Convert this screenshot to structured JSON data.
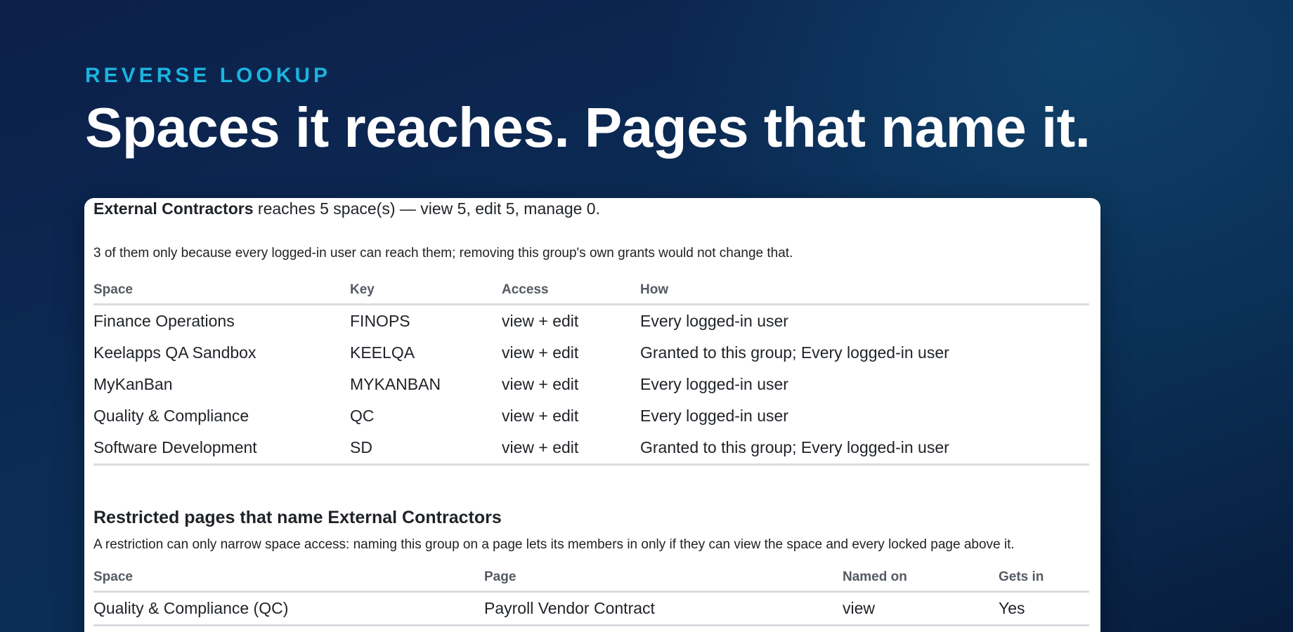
{
  "hero": {
    "eyebrow": "REVERSE LOOKUP",
    "headline": "Spaces it reaches. Pages that name it."
  },
  "summary": {
    "group_name": "External Contractors",
    "text": " reaches 5 space(s) — view 5, edit 5, manage 0.",
    "note": "3 of them only because every logged-in user can reach them; removing this group's own grants would not change that."
  },
  "spaces_table": {
    "headers": [
      "Space",
      "Key",
      "Access",
      "How"
    ],
    "rows": [
      [
        "Finance Operations",
        "FINOPS",
        "view + edit",
        "Every logged-in user"
      ],
      [
        "Keelapps QA Sandbox",
        "KEELQA",
        "view + edit",
        "Granted to this group; Every logged-in user"
      ],
      [
        "MyKanBan",
        "MYKANBAN",
        "view + edit",
        "Every logged-in user"
      ],
      [
        "Quality & Compliance",
        "QC",
        "view + edit",
        "Every logged-in user"
      ],
      [
        "Software Development",
        "SD",
        "view + edit",
        "Granted to this group; Every logged-in user"
      ]
    ]
  },
  "restricted": {
    "title": "Restricted pages that name External Contractors",
    "description": "A restriction can only narrow space access: naming this group on a page lets its members in only if they can view the space and every locked page above it.",
    "headers": [
      "Space",
      "Page",
      "Named on",
      "Gets in"
    ],
    "rows": [
      [
        "Quality & Compliance (QC)",
        "Payroll Vendor Contract",
        "view",
        "Yes"
      ]
    ]
  }
}
